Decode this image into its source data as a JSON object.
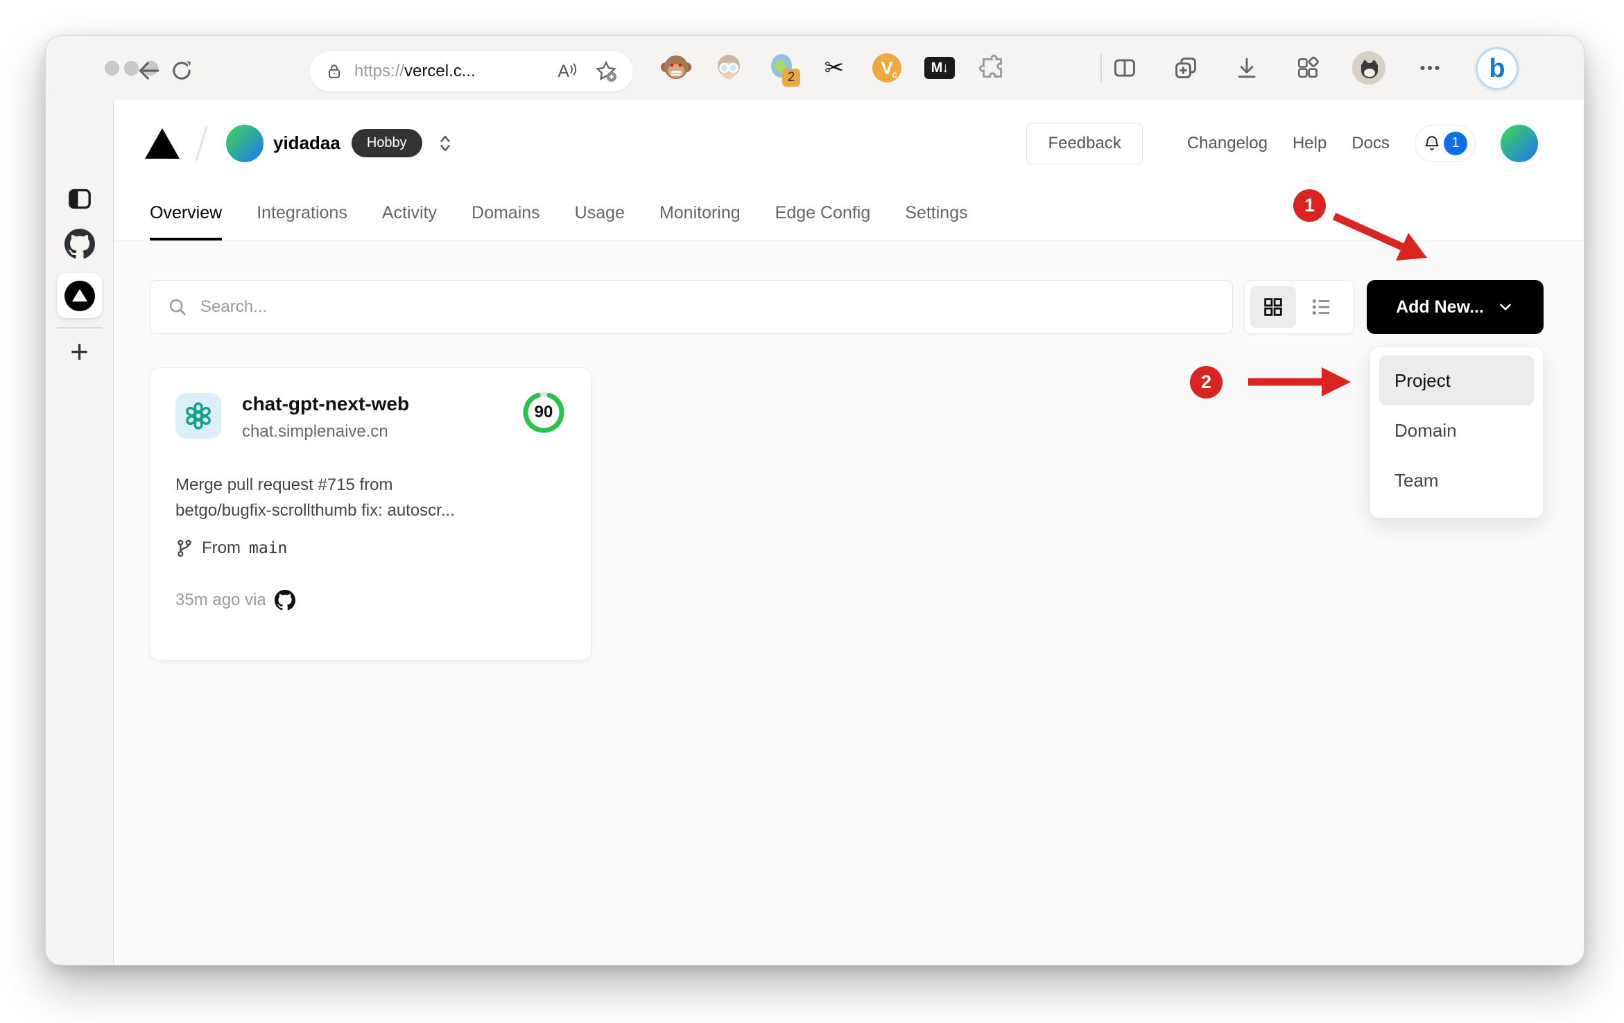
{
  "browser": {
    "url": {
      "scheme": "https://",
      "host": "vercel.c..."
    },
    "reader_label": "A",
    "translate_badge": "2",
    "scissors_glyph": "✂",
    "video_label": "V",
    "video_sub": "c",
    "markdown_label": "M↓",
    "bing_label": "b"
  },
  "sidebar": {
    "new_tab_glyph": "+"
  },
  "header": {
    "team_name": "yidadaa",
    "plan_badge": "Hobby",
    "feedback_label": "Feedback",
    "changelog_label": "Changelog",
    "help_label": "Help",
    "docs_label": "Docs",
    "notification_count": "1"
  },
  "tabs": {
    "items": [
      {
        "label": "Overview"
      },
      {
        "label": "Integrations"
      },
      {
        "label": "Activity"
      },
      {
        "label": "Domains"
      },
      {
        "label": "Usage"
      },
      {
        "label": "Monitoring"
      },
      {
        "label": "Edge Config"
      },
      {
        "label": "Settings"
      }
    ]
  },
  "controls": {
    "search_placeholder": "Search...",
    "add_new_label": "Add New..."
  },
  "dropdown": {
    "items": [
      {
        "label": "Project"
      },
      {
        "label": "Domain"
      },
      {
        "label": "Team"
      }
    ]
  },
  "card": {
    "name": "chat-gpt-next-web",
    "domain": "chat.simplenaive.cn",
    "score": "90",
    "commit_line1": "Merge pull request #715 from",
    "commit_line2": "betgo/bugfix-scrollthumb fix: autoscr...",
    "branch_prefix": "From",
    "branch_name": "main",
    "deployed_info": "35m ago via"
  },
  "annotations": {
    "step1": "1",
    "step2": "2"
  },
  "colors": {
    "accent_red": "#da2420",
    "score_green": "#2bc24a",
    "notification_blue": "#0b70e8",
    "hobby_badge_bg": "#333333",
    "openai_teal": "#17a08b",
    "content_bg": "#fafafa"
  }
}
